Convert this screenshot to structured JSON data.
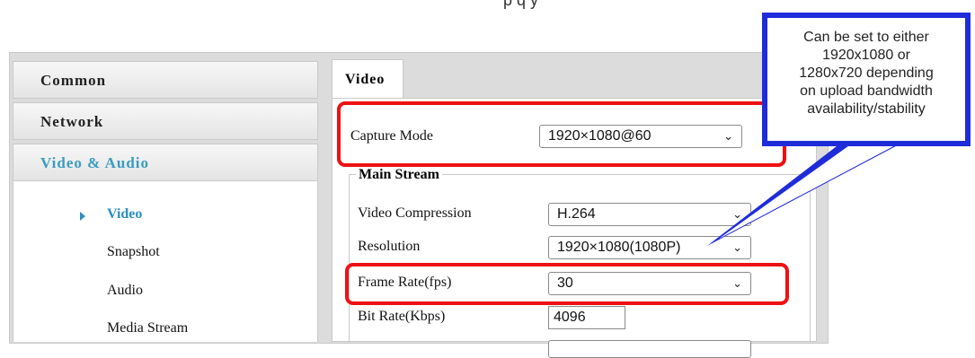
{
  "sidebar": {
    "sections": [
      {
        "label": "Common"
      },
      {
        "label": "Network"
      },
      {
        "label": "Video & Audio"
      }
    ],
    "items": [
      {
        "label": "Video"
      },
      {
        "label": "Snapshot"
      },
      {
        "label": "Audio"
      },
      {
        "label": "Media Stream"
      }
    ]
  },
  "main": {
    "tab_label": "Video",
    "capture_mode": {
      "label": "Capture Mode",
      "value": "1920×1080@60"
    },
    "main_stream": {
      "legend": "Main Stream",
      "video_compression": {
        "label": "Video Compression",
        "value": "H.264"
      },
      "resolution": {
        "label": "Resolution",
        "value": "1920×1080(1080P)"
      },
      "frame_rate": {
        "label": "Frame Rate(fps)",
        "value": "30"
      },
      "bit_rate": {
        "label": "Bit Rate(Kbps)",
        "value": "4096"
      }
    }
  },
  "callout": {
    "lines": [
      "Can be set to either",
      "1920x1080 or",
      "1280x720 depending",
      "on upload bandwidth",
      "availability/stability"
    ]
  },
  "colors": {
    "highlight": "#ee1111",
    "callout_border": "#1e2cd9",
    "active_nav": "#3a9cc0"
  }
}
